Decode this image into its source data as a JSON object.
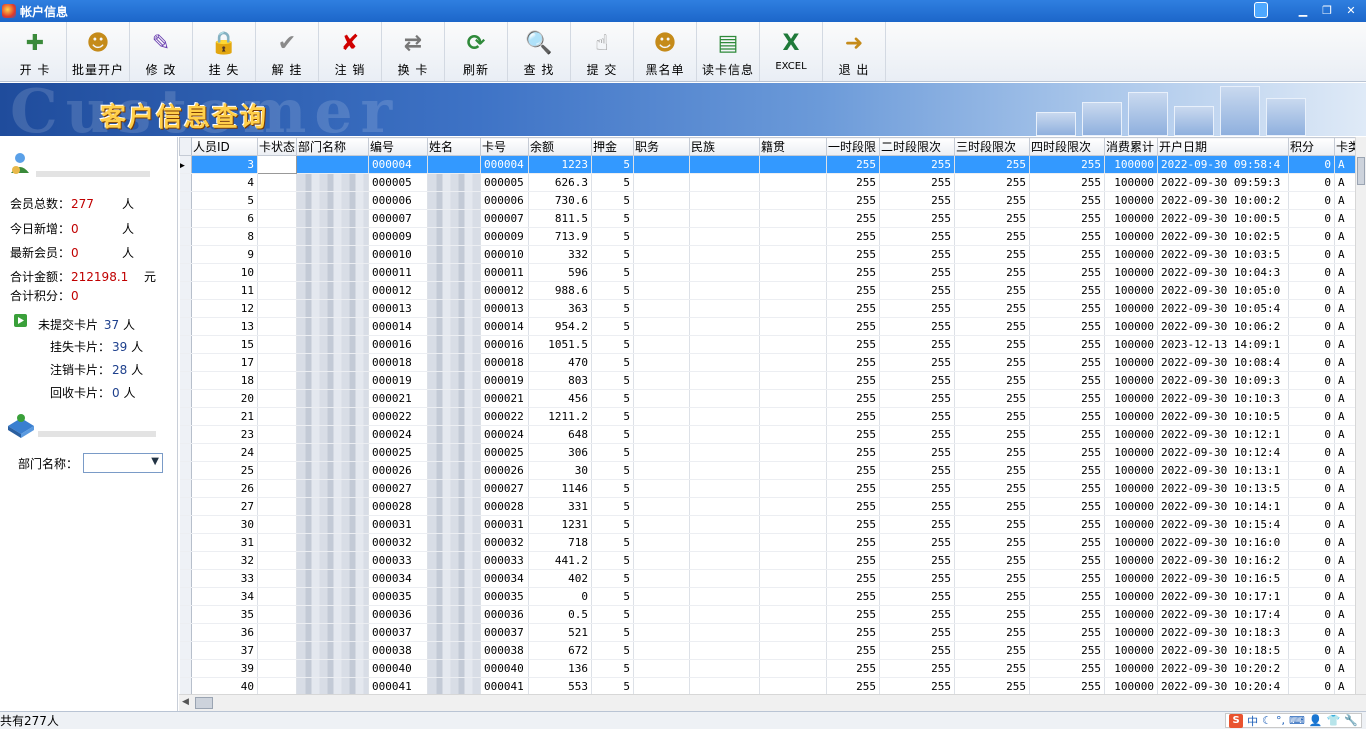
{
  "window": {
    "title": "帐户信息"
  },
  "toolbar": [
    {
      "key": "open-card",
      "label": "开 卡",
      "icon": "open-card-icon",
      "glyph": "✚",
      "color": "#3a8a3a"
    },
    {
      "key": "batch-open",
      "label": "批量开户",
      "icon": "batch-users-icon",
      "glyph": "☻",
      "color": "#c58b1a"
    },
    {
      "key": "edit",
      "label": "修 改",
      "icon": "edit-pencil-icon",
      "glyph": "✎",
      "color": "#6a3fb0"
    },
    {
      "key": "report-loss",
      "label": "挂 失",
      "icon": "lock-user-icon",
      "glyph": "🔒",
      "color": "#c02020"
    },
    {
      "key": "unreport-loss",
      "label": "解 挂",
      "icon": "check-icon",
      "glyph": "✔",
      "color": "#8a8a8a"
    },
    {
      "key": "cancel",
      "label": "注 销",
      "icon": "x-cancel-icon",
      "glyph": "✘",
      "color": "#d00000"
    },
    {
      "key": "change-card",
      "label": "换 卡",
      "icon": "swap-card-icon",
      "glyph": "⇄",
      "color": "#777777"
    },
    {
      "key": "refresh",
      "label": "刷新",
      "icon": "refresh-icon",
      "glyph": "⟳",
      "color": "#2f8a3a"
    },
    {
      "key": "search",
      "label": "查 找",
      "icon": "search-icon",
      "glyph": "🔍",
      "color": "#1d5fb8"
    },
    {
      "key": "submit",
      "label": "提 交",
      "icon": "submit-icon",
      "glyph": "☝",
      "color": "#8a8a8a"
    },
    {
      "key": "blacklist",
      "label": "黑名单",
      "icon": "blacklist-users-icon",
      "glyph": "☻",
      "color": "#c58b1a"
    },
    {
      "key": "read-card",
      "label": "读卡信息",
      "icon": "read-card-icon",
      "glyph": "▤",
      "color": "#2f8a3a"
    },
    {
      "key": "excel",
      "label": "EXCEL",
      "icon": "excel-icon",
      "glyph": "X",
      "color": "#1f7a3a",
      "small": true
    },
    {
      "key": "exit",
      "label": "退 出",
      "icon": "exit-icon",
      "glyph": "➜",
      "color": "#c58b1a"
    }
  ],
  "banner": {
    "watermark": "Customer",
    "title": "客户信息查询"
  },
  "stats": {
    "total_label": "会员总数：",
    "total_value": "277",
    "total_unit": "人",
    "today_label": "今日新增：",
    "today_value": "0",
    "today_unit": "人",
    "latest_label": "最新会员：",
    "latest_value": "0",
    "latest_unit": "人",
    "amount_label": "合计金额：",
    "amount_value": "212198.1",
    "amount_unit": "元",
    "points_label": "合计积分：",
    "points_value": "0"
  },
  "cards": {
    "unsubmitted_label": "未提交卡片",
    "unsubmitted_value": "37",
    "unsubmitted_unit": "人",
    "lost_label": "挂失卡片：",
    "lost_value": "39",
    "lost_unit": "人",
    "cancelled_label": "注销卡片：",
    "cancelled_value": "28",
    "cancelled_unit": "人",
    "recycled_label": "回收卡片：",
    "recycled_value": "0",
    "recycled_unit": "人"
  },
  "filter": {
    "dept_label": "部门名称：",
    "dept_value": ""
  },
  "grid": {
    "columns": [
      "人员ID",
      "卡状态",
      "部门名称",
      "编号",
      "姓名",
      "卡号",
      "余额",
      "押金",
      "职务",
      "民族",
      "籍贯",
      "一时段限",
      "二时段限次",
      "三时段限次",
      "四时段限次",
      "消费累计",
      "开户日期",
      "积分",
      "卡类"
    ],
    "rows": [
      [
        "3",
        "",
        "",
        "000004",
        "",
        "000004",
        "1223",
        "5",
        "",
        "",
        "",
        "255",
        "255",
        "255",
        "255",
        "100000",
        "2022-09-30 09:58:4",
        "0",
        "A"
      ],
      [
        "4",
        "",
        "",
        "000005",
        "",
        "000005",
        "626.3",
        "5",
        "",
        "",
        "",
        "255",
        "255",
        "255",
        "255",
        "100000",
        "2022-09-30 09:59:3",
        "0",
        "A"
      ],
      [
        "5",
        "",
        "",
        "000006",
        "",
        "000006",
        "730.6",
        "5",
        "",
        "",
        "",
        "255",
        "255",
        "255",
        "255",
        "100000",
        "2022-09-30 10:00:2",
        "0",
        "A"
      ],
      [
        "6",
        "",
        "",
        "000007",
        "",
        "000007",
        "811.5",
        "5",
        "",
        "",
        "",
        "255",
        "255",
        "255",
        "255",
        "100000",
        "2022-09-30 10:00:5",
        "0",
        "A"
      ],
      [
        "8",
        "",
        "",
        "000009",
        "",
        "000009",
        "713.9",
        "5",
        "",
        "",
        "",
        "255",
        "255",
        "255",
        "255",
        "100000",
        "2022-09-30 10:02:5",
        "0",
        "A"
      ],
      [
        "9",
        "",
        "",
        "000010",
        "",
        "000010",
        "332",
        "5",
        "",
        "",
        "",
        "255",
        "255",
        "255",
        "255",
        "100000",
        "2022-09-30 10:03:5",
        "0",
        "A"
      ],
      [
        "10",
        "",
        "",
        "000011",
        "",
        "000011",
        "596",
        "5",
        "",
        "",
        "",
        "255",
        "255",
        "255",
        "255",
        "100000",
        "2022-09-30 10:04:3",
        "0",
        "A"
      ],
      [
        "11",
        "",
        "",
        "000012",
        "",
        "000012",
        "988.6",
        "5",
        "",
        "",
        "",
        "255",
        "255",
        "255",
        "255",
        "100000",
        "2022-09-30 10:05:0",
        "0",
        "A"
      ],
      [
        "12",
        "",
        "",
        "000013",
        "",
        "000013",
        "363",
        "5",
        "",
        "",
        "",
        "255",
        "255",
        "255",
        "255",
        "100000",
        "2022-09-30 10:05:4",
        "0",
        "A"
      ],
      [
        "13",
        "",
        "",
        "000014",
        "",
        "000014",
        "954.2",
        "5",
        "",
        "",
        "",
        "255",
        "255",
        "255",
        "255",
        "100000",
        "2022-09-30 10:06:2",
        "0",
        "A"
      ],
      [
        "15",
        "",
        "",
        "000016",
        "",
        "000016",
        "1051.5",
        "5",
        "",
        "",
        "",
        "255",
        "255",
        "255",
        "255",
        "100000",
        "2023-12-13 14:09:1",
        "0",
        "A"
      ],
      [
        "17",
        "",
        "",
        "000018",
        "",
        "000018",
        "470",
        "5",
        "",
        "",
        "",
        "255",
        "255",
        "255",
        "255",
        "100000",
        "2022-09-30 10:08:4",
        "0",
        "A"
      ],
      [
        "18",
        "",
        "",
        "000019",
        "",
        "000019",
        "803",
        "5",
        "",
        "",
        "",
        "255",
        "255",
        "255",
        "255",
        "100000",
        "2022-09-30 10:09:3",
        "0",
        "A"
      ],
      [
        "20",
        "",
        "",
        "000021",
        "",
        "000021",
        "456",
        "5",
        "",
        "",
        "",
        "255",
        "255",
        "255",
        "255",
        "100000",
        "2022-09-30 10:10:3",
        "0",
        "A"
      ],
      [
        "21",
        "",
        "",
        "000022",
        "",
        "000022",
        "1211.2",
        "5",
        "",
        "",
        "",
        "255",
        "255",
        "255",
        "255",
        "100000",
        "2022-09-30 10:10:5",
        "0",
        "A"
      ],
      [
        "23",
        "",
        "",
        "000024",
        "",
        "000024",
        "648",
        "5",
        "",
        "",
        "",
        "255",
        "255",
        "255",
        "255",
        "100000",
        "2022-09-30 10:12:1",
        "0",
        "A"
      ],
      [
        "24",
        "",
        "",
        "000025",
        "",
        "000025",
        "306",
        "5",
        "",
        "",
        "",
        "255",
        "255",
        "255",
        "255",
        "100000",
        "2022-09-30 10:12:4",
        "0",
        "A"
      ],
      [
        "25",
        "",
        "",
        "000026",
        "",
        "000026",
        "30",
        "5",
        "",
        "",
        "",
        "255",
        "255",
        "255",
        "255",
        "100000",
        "2022-09-30 10:13:1",
        "0",
        "A"
      ],
      [
        "26",
        "",
        "",
        "000027",
        "",
        "000027",
        "1146",
        "5",
        "",
        "",
        "",
        "255",
        "255",
        "255",
        "255",
        "100000",
        "2022-09-30 10:13:5",
        "0",
        "A"
      ],
      [
        "27",
        "",
        "",
        "000028",
        "",
        "000028",
        "331",
        "5",
        "",
        "",
        "",
        "255",
        "255",
        "255",
        "255",
        "100000",
        "2022-09-30 10:14:1",
        "0",
        "A"
      ],
      [
        "30",
        "",
        "",
        "000031",
        "",
        "000031",
        "1231",
        "5",
        "",
        "",
        "",
        "255",
        "255",
        "255",
        "255",
        "100000",
        "2022-09-30 10:15:4",
        "0",
        "A"
      ],
      [
        "31",
        "",
        "",
        "000032",
        "",
        "000032",
        "718",
        "5",
        "",
        "",
        "",
        "255",
        "255",
        "255",
        "255",
        "100000",
        "2022-09-30 10:16:0",
        "0",
        "A"
      ],
      [
        "32",
        "",
        "",
        "000033",
        "",
        "000033",
        "441.2",
        "5",
        "",
        "",
        "",
        "255",
        "255",
        "255",
        "255",
        "100000",
        "2022-09-30 10:16:2",
        "0",
        "A"
      ],
      [
        "33",
        "",
        "",
        "000034",
        "",
        "000034",
        "402",
        "5",
        "",
        "",
        "",
        "255",
        "255",
        "255",
        "255",
        "100000",
        "2022-09-30 10:16:5",
        "0",
        "A"
      ],
      [
        "34",
        "",
        "",
        "000035",
        "",
        "000035",
        "0",
        "5",
        "",
        "",
        "",
        "255",
        "255",
        "255",
        "255",
        "100000",
        "2022-09-30 10:17:1",
        "0",
        "A"
      ],
      [
        "35",
        "",
        "",
        "000036",
        "",
        "000036",
        "0.5",
        "5",
        "",
        "",
        "",
        "255",
        "255",
        "255",
        "255",
        "100000",
        "2022-09-30 10:17:4",
        "0",
        "A"
      ],
      [
        "36",
        "",
        "",
        "000037",
        "",
        "000037",
        "521",
        "5",
        "",
        "",
        "",
        "255",
        "255",
        "255",
        "255",
        "100000",
        "2022-09-30 10:18:3",
        "0",
        "A"
      ],
      [
        "37",
        "",
        "",
        "000038",
        "",
        "000038",
        "672",
        "5",
        "",
        "",
        "",
        "255",
        "255",
        "255",
        "255",
        "100000",
        "2022-09-30 10:18:5",
        "0",
        "A"
      ],
      [
        "39",
        "",
        "",
        "000040",
        "",
        "000040",
        "136",
        "5",
        "",
        "",
        "",
        "255",
        "255",
        "255",
        "255",
        "100000",
        "2022-09-30 10:20:2",
        "0",
        "A"
      ],
      [
        "40",
        "",
        "",
        "000041",
        "",
        "000041",
        "553",
        "5",
        "",
        "",
        "",
        "255",
        "255",
        "255",
        "255",
        "100000",
        "2022-09-30 10:20:4",
        "0",
        "A"
      ]
    ]
  },
  "status": {
    "text": "共有277人",
    "ime_logo": "S",
    "ime_lang": "中"
  }
}
